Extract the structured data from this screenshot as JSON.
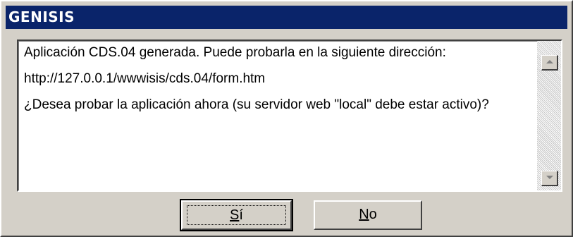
{
  "window": {
    "title": "GENISIS"
  },
  "message": {
    "line1": "Aplicación CDS.04 generada. Puede probarla en la siguiente dirección:",
    "url": "http://127.0.0.1/wwwisis/cds.04/form.htm",
    "question": "¿Desea probar la aplicación ahora (su servidor web \"local\" debe estar activo)?"
  },
  "scrollbar": {
    "up_icon": "scroll-up-arrow-icon",
    "down_icon": "scroll-down-arrow-icon"
  },
  "buttons": {
    "yes": {
      "mnemonic": "S",
      "rest": "í"
    },
    "no": {
      "mnemonic": "N",
      "rest": "o"
    }
  },
  "colors": {
    "titlebar": "#0a246a",
    "face": "#d4d0c8"
  }
}
